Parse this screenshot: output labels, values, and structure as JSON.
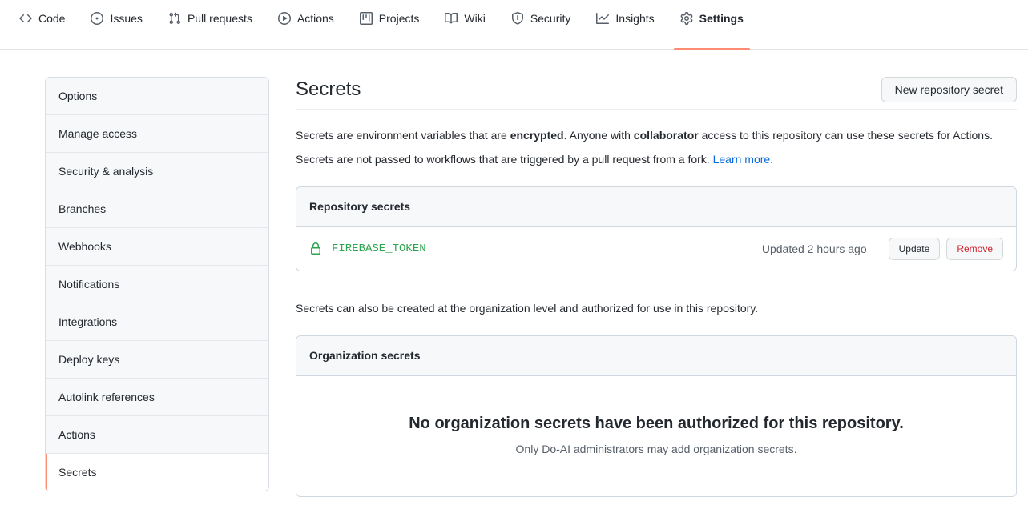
{
  "repo_nav": {
    "items": [
      {
        "label": "Code",
        "icon": "code-icon",
        "active": false
      },
      {
        "label": "Issues",
        "icon": "issue-opened-icon",
        "active": false
      },
      {
        "label": "Pull requests",
        "icon": "git-pull-request-icon",
        "active": false
      },
      {
        "label": "Actions",
        "icon": "play-icon",
        "active": false
      },
      {
        "label": "Projects",
        "icon": "project-icon",
        "active": false
      },
      {
        "label": "Wiki",
        "icon": "book-icon",
        "active": false
      },
      {
        "label": "Security",
        "icon": "shield-icon",
        "active": false
      },
      {
        "label": "Insights",
        "icon": "graph-icon",
        "active": false
      },
      {
        "label": "Settings",
        "icon": "gear-icon",
        "active": true
      }
    ]
  },
  "sidebar": {
    "items": [
      {
        "label": "Options",
        "selected": false
      },
      {
        "label": "Manage access",
        "selected": false
      },
      {
        "label": "Security & analysis",
        "selected": false
      },
      {
        "label": "Branches",
        "selected": false
      },
      {
        "label": "Webhooks",
        "selected": false
      },
      {
        "label": "Notifications",
        "selected": false
      },
      {
        "label": "Integrations",
        "selected": false
      },
      {
        "label": "Deploy keys",
        "selected": false
      },
      {
        "label": "Autolink references",
        "selected": false
      },
      {
        "label": "Actions",
        "selected": false
      },
      {
        "label": "Secrets",
        "selected": true
      }
    ]
  },
  "main": {
    "title": "Secrets",
    "new_secret_button": "New repository secret",
    "description_1": {
      "part1": "Secrets are environment variables that are ",
      "bold1": "encrypted",
      "part2": ". Anyone with ",
      "bold2": "collaborator",
      "part3": " access to this repository can use these secrets for Actions."
    },
    "description_2": {
      "part1": "Secrets are not passed to workflows that are triggered by a pull request from a fork. ",
      "link": "Learn more",
      "part2": "."
    },
    "repository_secrets": {
      "header": "Repository secrets",
      "rows": [
        {
          "icon": "lock-icon",
          "name": "FIREBASE_TOKEN",
          "updated": "Updated 2 hours ago",
          "update_button": "Update",
          "remove_button": "Remove"
        }
      ]
    },
    "org_description": "Secrets can also be created at the organization level and authorized for use in this repository.",
    "organization_secrets": {
      "header": "Organization secrets",
      "blankslate_heading": "No organization secrets have been authorized for this repository.",
      "blankslate_sub": "Only Do-AI administrators may add organization secrets."
    }
  },
  "colors": {
    "accent_underline": "#fd8c73",
    "link": "#0969da",
    "secret_green": "#2da44e",
    "danger": "#cf222e",
    "border": "#d0d7de",
    "muted_bg": "#f6f8fa"
  }
}
